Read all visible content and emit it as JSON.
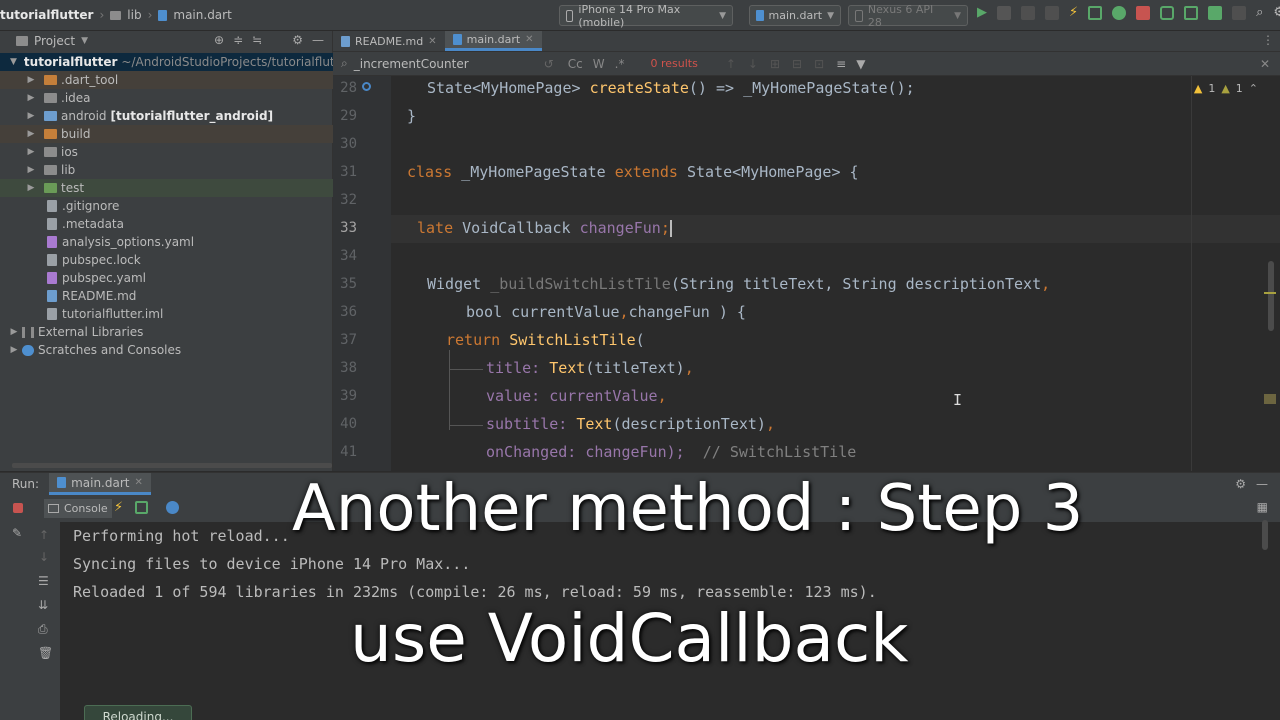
{
  "breadcrumb": [
    "tutorialflutter",
    "lib",
    "main.dart"
  ],
  "toolbar": {
    "device": "iPhone 14 Pro Max (mobile)",
    "run_config": "main.dart",
    "emulator": "Nexus 6 API 28"
  },
  "project": {
    "header": "Project",
    "root_name": "tutorialflutter",
    "root_path": "~/AndroidStudioProjects/tutorialflutt",
    "items": [
      {
        "label": ".dart_tool",
        "type": "folder-orange"
      },
      {
        "label": ".idea",
        "type": "folder"
      },
      {
        "label": "android",
        "suffix": "[tutorialflutter_android]",
        "type": "folder-blue"
      },
      {
        "label": "build",
        "type": "folder-orange"
      },
      {
        "label": "ios",
        "type": "folder"
      },
      {
        "label": "lib",
        "type": "folder"
      },
      {
        "label": "test",
        "type": "folder-green"
      },
      {
        "label": ".gitignore",
        "type": "file"
      },
      {
        "label": ".metadata",
        "type": "file"
      },
      {
        "label": "analysis_options.yaml",
        "type": "yaml"
      },
      {
        "label": "pubspec.lock",
        "type": "file"
      },
      {
        "label": "pubspec.yaml",
        "type": "yaml"
      },
      {
        "label": "README.md",
        "type": "md"
      },
      {
        "label": "tutorialflutter.iml",
        "type": "file"
      }
    ],
    "external": "External Libraries",
    "scratches": "Scratches and Consoles"
  },
  "tabs": [
    {
      "label": "README.md",
      "active": false
    },
    {
      "label": "main.dart",
      "active": true
    }
  ],
  "find": {
    "query": "_incrementCounter",
    "results": "0 results",
    "warnings": "1",
    "weak_warnings": "1"
  },
  "code": {
    "line_numbers": [
      "28",
      "29",
      "30",
      "31",
      "32",
      "33",
      "34",
      "35",
      "36",
      "37",
      "38",
      "39",
      "40",
      "41"
    ],
    "l28_a": "State<MyHomePage> ",
    "l28_fn": "createState",
    "l28_b": "() => _MyHomePageState();",
    "l29": "}",
    "l31_kw": "class",
    "l31_a": " _MyHomePageState ",
    "l31_kw2": "extends",
    "l31_b": " State<MyHomePage> {",
    "l33_kw": "late",
    "l33_a": " VoidCallback ",
    "l33_pr": "changeFun",
    "l33_b": ";",
    "l35_a": "Widget ",
    "l35_gr": "_buildSwitchListTile",
    "l35_b": "(String titleText, String descriptionText",
    "l35_c": ",",
    "l36_a": "bool currentValue",
    "l36_b": ",",
    "l36_c": "changeFun ) {",
    "l37_kw": "return ",
    "l37_fn": "SwitchListTile",
    "l37_b": "(",
    "l38_a": "title: ",
    "l38_fn": "Text",
    "l38_b": "(titleText)",
    "l38_c": ",",
    "l39_a": "value: currentValue",
    "l39_b": ",",
    "l40_a": "subtitle: ",
    "l40_fn": "Text",
    "l40_b": "(descriptionText)",
    "l40_c": ",",
    "l41_a": "onChanged: changeFun);  ",
    "l41_cm": "// SwitchListTile"
  },
  "run": {
    "label": "Run:",
    "tab": "main.dart",
    "console_tab": "Console",
    "lines": [
      "Performing hot reload...",
      "Syncing files to device iPhone 14 Pro Max...",
      "Reloaded 1 of 594 libraries in 232ms (compile: 26 ms, reload: 59 ms, reassemble: 123 ms)."
    ],
    "badge": "Reloading..."
  },
  "caption": {
    "line1": "Another method :  Step 3",
    "line2": "use VoidCallback"
  },
  "colors": {
    "keyword": "#cc7832",
    "function": "#ffc66d",
    "property": "#9876aa",
    "comment": "#808080",
    "accent": "#4a88c7"
  }
}
